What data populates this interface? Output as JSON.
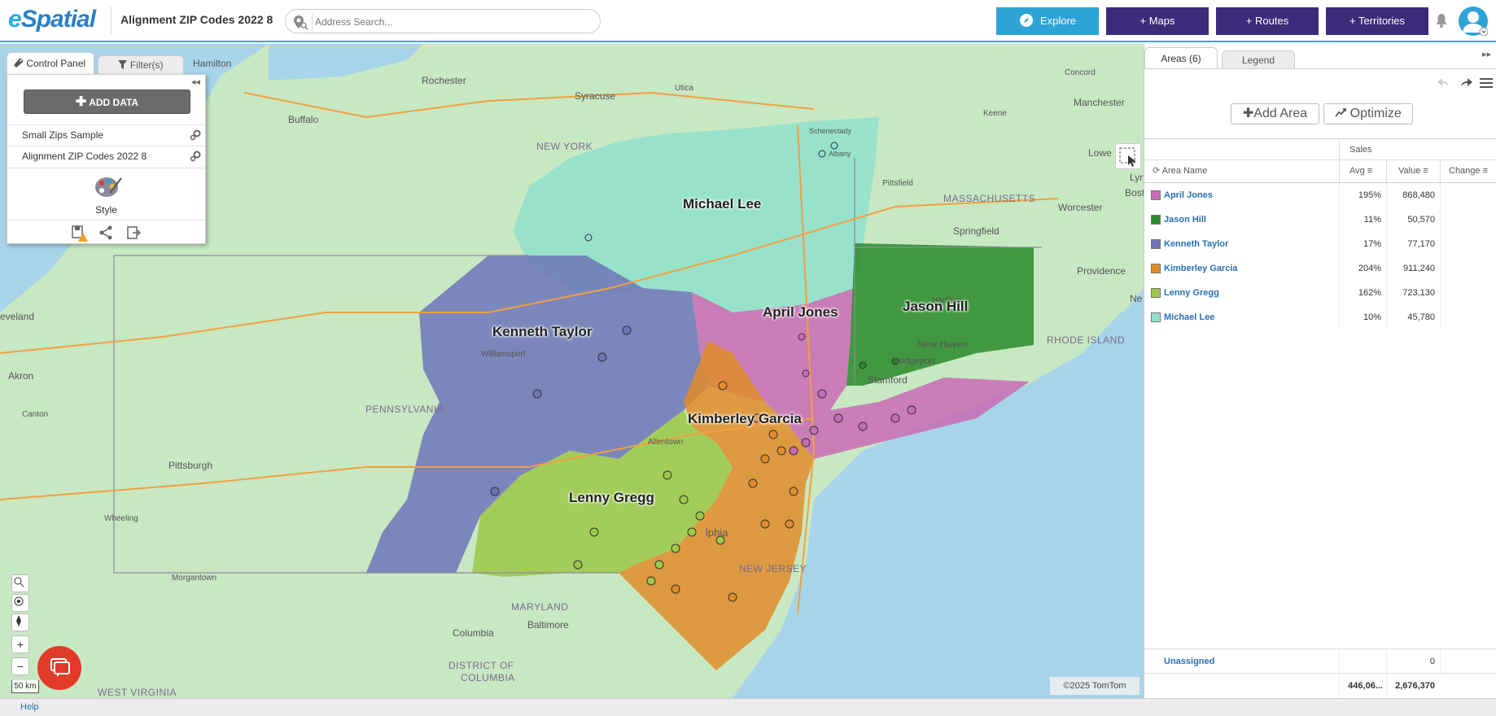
{
  "header": {
    "logo_e": "e",
    "logo_rest": "Spatial",
    "map_title": "Alignment ZIP Codes 2022 8",
    "search_placeholder": "Address Search...",
    "explore_label": "Explore",
    "maps_label": "+ Maps",
    "routes_label": "+ Routes",
    "territories_label": "+ Territories",
    "accent_color": "#2ea3d6",
    "nav_color": "#3d2a78"
  },
  "control_panel": {
    "tab_control": "Control Panel",
    "tab_filters": "Filter(s)",
    "add_data_label": "ADD DATA",
    "layers": [
      {
        "name": "Small Zips Sample"
      },
      {
        "name": "Alignment ZIP Codes 2022 8"
      }
    ],
    "style_label": "Style"
  },
  "map": {
    "area_labels": {
      "michael_lee": "Michael Lee",
      "kenneth_taylor": "Kenneth Taylor",
      "april_jones": "April Jones",
      "jason_hill": "Jason Hill",
      "kimberley_garcia": "Kimberley Garcia",
      "lenny_gregg": "Lenny Gregg"
    },
    "places": {
      "hamilton": "Hamilton",
      "rochester": "Rochester",
      "syracuse": "Syracuse",
      "utica": "Utica",
      "buffalo": "Buffalo",
      "schenectady": "Schenectady",
      "albany": "Albany",
      "concord": "Concord",
      "manchester": "Manchester",
      "keene": "Keene",
      "lowell": "Lowe",
      "pittsfield": "Pittsfield",
      "worcester": "Worcester",
      "springfield": "Springfield",
      "boston": "Boston",
      "providence": "Providence",
      "hartford": "Hartford",
      "new_haven": "New Haven",
      "bridgeport": "Bridgeport",
      "stamford": "Stamford",
      "cleveland": "eveland",
      "akron": "Akron",
      "canton": "Canton",
      "williamsport": "Williamsport",
      "allentown": "Allentown",
      "pittsburgh": "Pittsburgh",
      "wheeling": "Wheeling",
      "morgantown": "Morgantown",
      "philadelphia": "lphia",
      "baltimore": "Baltimore",
      "columbia": "Columbia",
      "newport": "Ne",
      "lynn": "Lyn"
    },
    "states": {
      "new_york": "NEW YORK",
      "massachusetts": "MASSACHUSETTS",
      "rhode_island": "RHODE ISLAND",
      "pennsylvania": "PENNSYLVANIA",
      "new_jersey": "NEW JERSEY",
      "maryland": "MARYLAND",
      "district_of_columbia_1": "DISTRICT OF",
      "district_of_columbia_2": "COLUMBIA",
      "west_virginia": "WEST VIRGINIA"
    },
    "copyright": "©2025 TomTom",
    "scale": "50 km"
  },
  "right_panel": {
    "tab_areas": "Areas (6)",
    "tab_legend": "Legend",
    "add_area_label": "Add Area",
    "optimize_label": "Optimize",
    "group_header": "Sales",
    "columns": {
      "area_name": "Area Name",
      "avg": "Avg",
      "value": "Value",
      "change": "Change"
    },
    "rows": [
      {
        "name": "April Jones",
        "avg": "195%",
        "value": "868,480",
        "change": "",
        "color": "#c96bb5"
      },
      {
        "name": "Jason Hill",
        "avg": "11%",
        "value": "50,570",
        "change": "",
        "color": "#2a8a2a"
      },
      {
        "name": "Kenneth Taylor",
        "avg": "17%",
        "value": "77,170",
        "change": "",
        "color": "#6d74b8"
      },
      {
        "name": "Kimberley Garcia",
        "avg": "204%",
        "value": "911,240",
        "change": "",
        "color": "#e08c2a"
      },
      {
        "name": "Lenny Gregg",
        "avg": "162%",
        "value": "723,130",
        "change": "",
        "color": "#9cc848"
      },
      {
        "name": "Michael Lee",
        "avg": "10%",
        "value": "45,780",
        "change": "",
        "color": "#8fe0cc"
      }
    ],
    "unassigned_label": "Unassigned",
    "unassigned_value": "0",
    "total_avg": "446,06...",
    "total_value": "2,676,370"
  },
  "footer": {
    "help_label": "Help"
  }
}
